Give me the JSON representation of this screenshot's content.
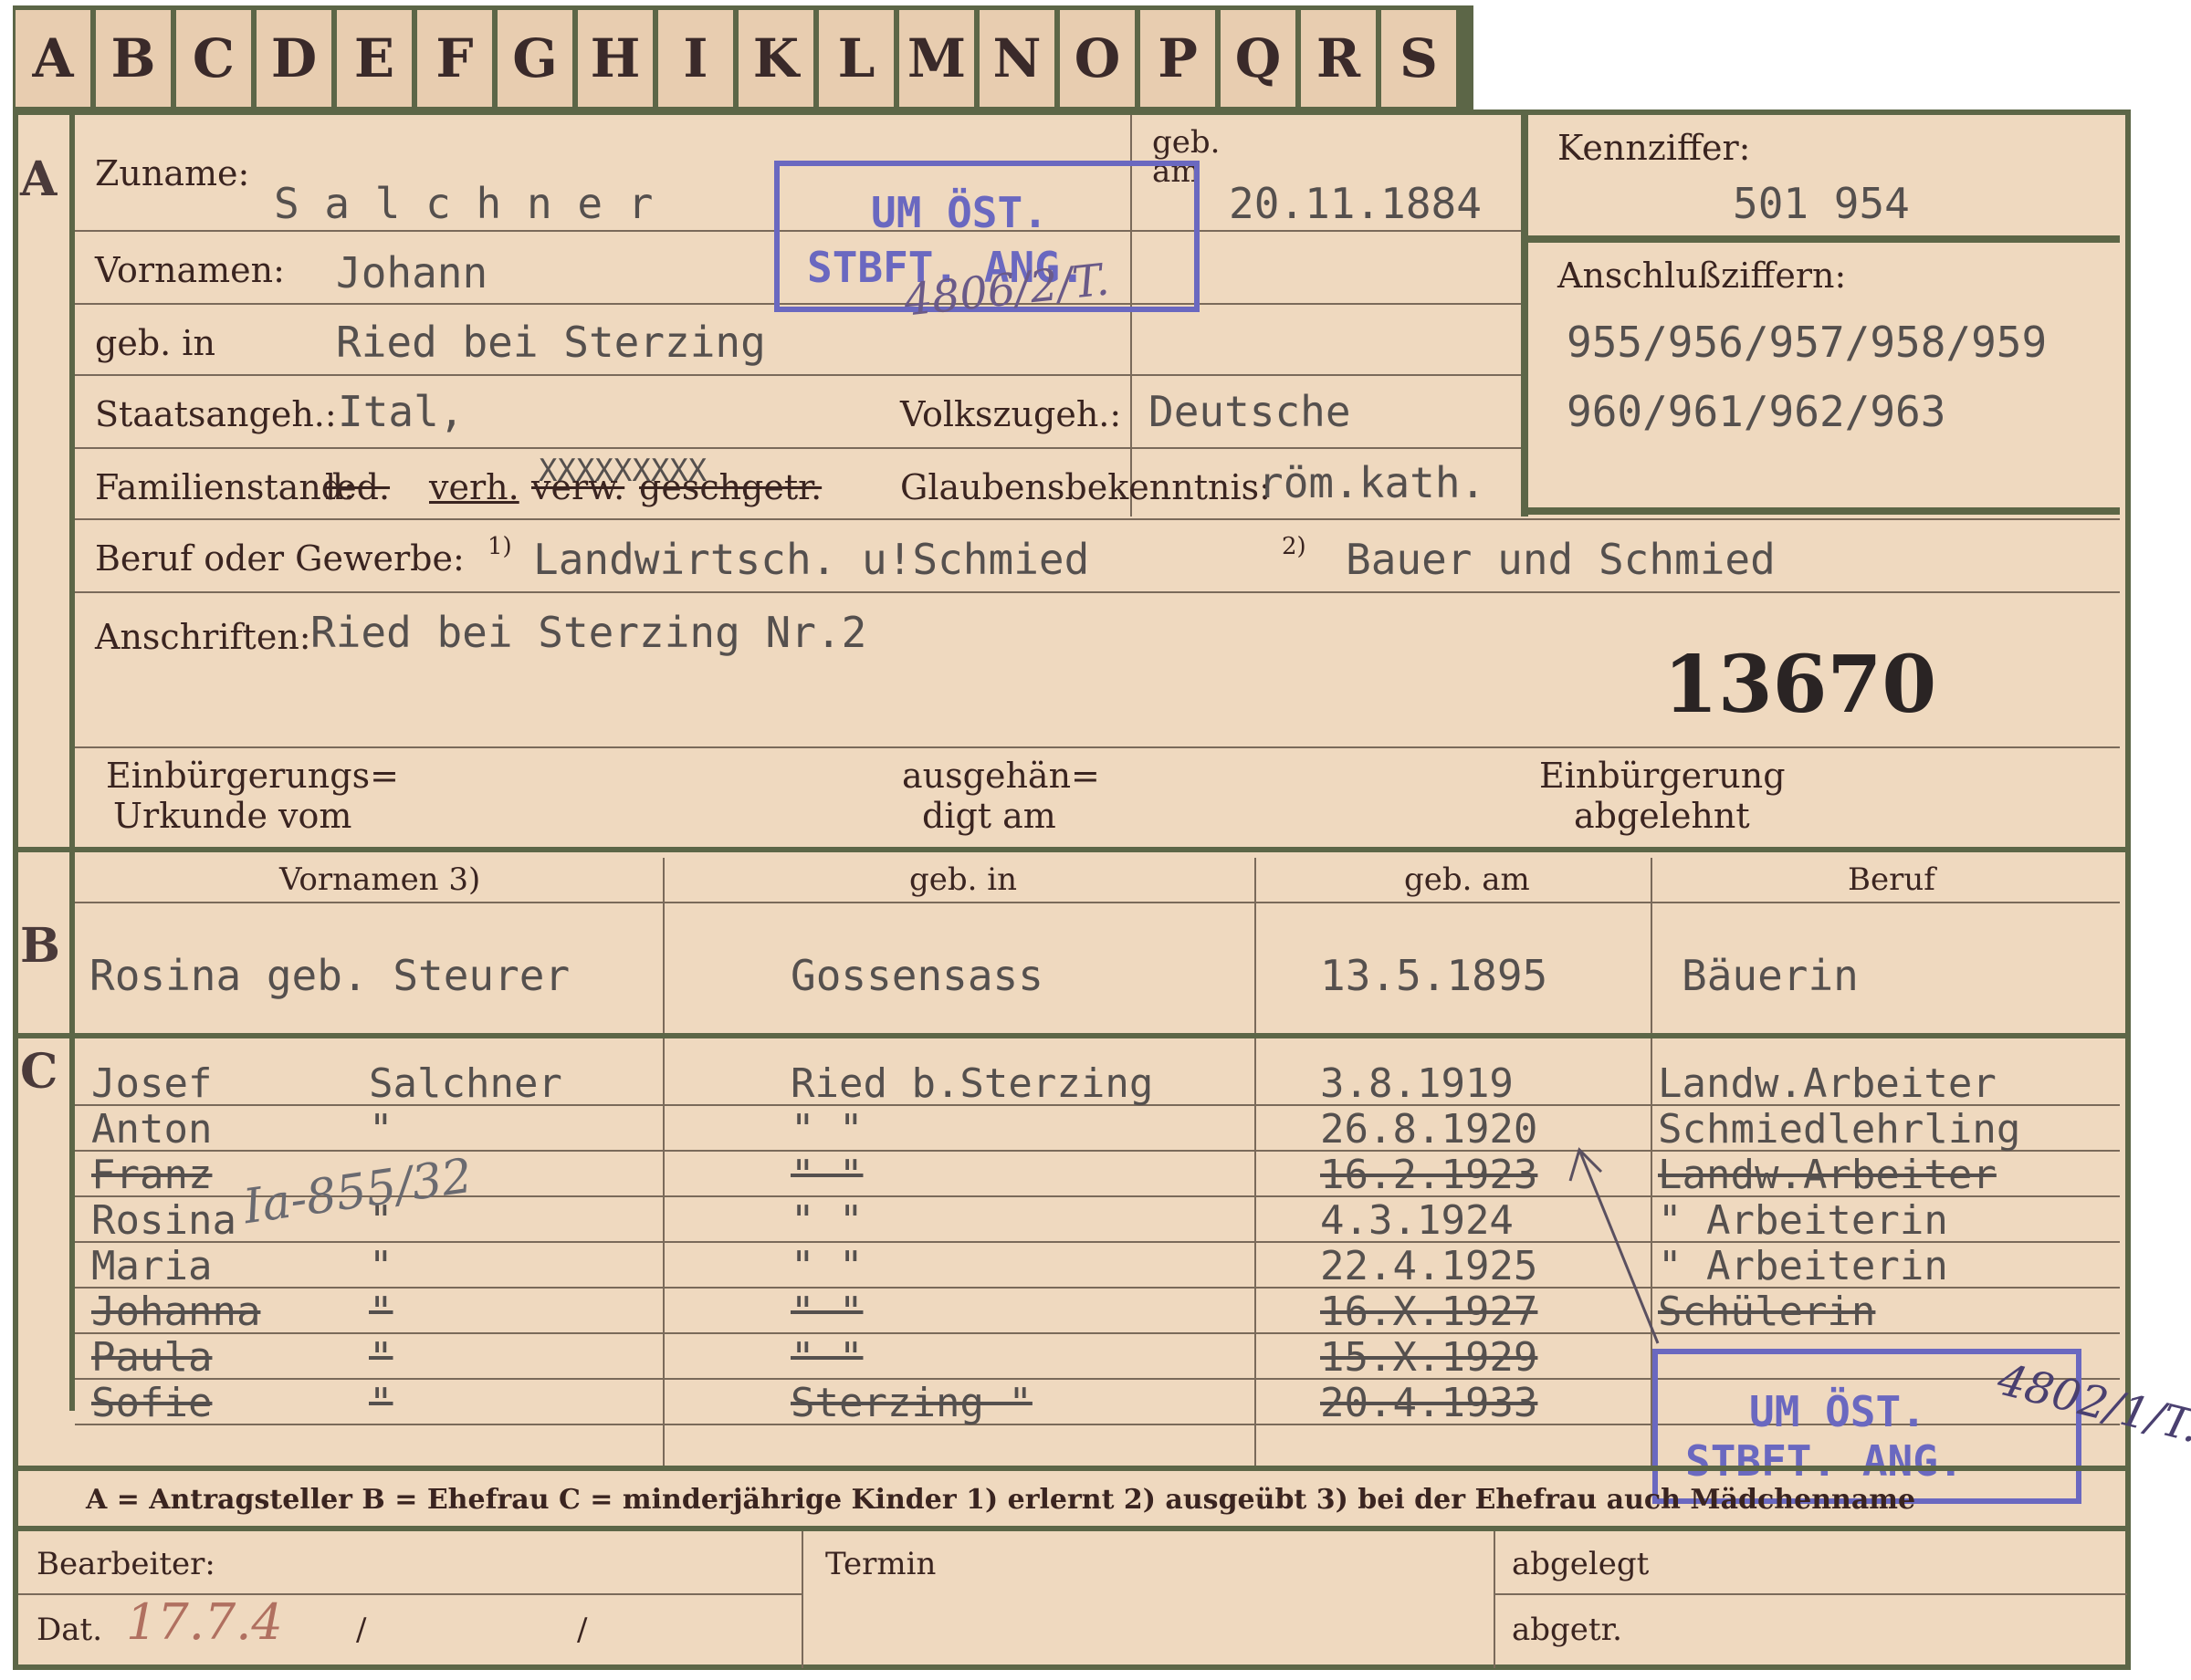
{
  "tabs": [
    "A",
    "B",
    "C",
    "D",
    "E",
    "F",
    "G",
    "H",
    "I",
    "K",
    "L",
    "M",
    "N",
    "O",
    "P",
    "Q",
    "R",
    "S"
  ],
  "section_letters": {
    "a": "A",
    "b": "B",
    "c": "C"
  },
  "a": {
    "zuname_label": "Zuname:",
    "zuname": "S a l c h n e r",
    "geb_label": "geb. am",
    "geb_date": "20.11.1884",
    "kennziffer_label": "Kennziffer:",
    "kennziffer": "501 954",
    "vornamen_label": "Vornamen:",
    "vornamen": "Johann",
    "geb_in_label": "geb. in",
    "geb_in": "Ried bei Sterzing",
    "anschluss_label": "Anschlußziffern:",
    "anschluss_1": "955/956/957/958/959",
    "anschluss_2": "960/961/962/963",
    "staats_label": "Staatsangeh.:",
    "staats": "Ital,",
    "volks_label": "Volkszugeh.:",
    "volks": "Deutsche",
    "familien_label": "Familienstand:",
    "familien_led": "led.",
    "familien_verh": "verh.",
    "familien_verw": "verw.",
    "familien_gesch": "gesch.",
    "familien_getr": "getr.",
    "familien_typed": "XXXXXXXXX",
    "glauben_label": "Glaubensbekenntnis:",
    "glauben": "röm.kath.",
    "beruf_label": "Beruf oder Gewerbe:",
    "beruf_1_mark": "1)",
    "beruf_1": "Landwirtsch. u!Schmied",
    "beruf_2_mark": "2)",
    "beruf_2": "Bauer und Schmied",
    "anschrift_label": "Anschriften:",
    "anschrift": "Ried bei Sterzing Nr.2",
    "number": "13670",
    "einb_urkunde_1": "Einbürgerungs=",
    "einb_urkunde_2": "Urkunde vom",
    "ausgehaend_1": "ausgehän=",
    "ausgehaend_2": "digt am",
    "einb_abgelehnt_1": "Einbürgerung",
    "einb_abgelehnt_2": "abgelehnt"
  },
  "stamp_top": {
    "line1": "UM ÖST.",
    "line2": "STBFT. ANG.",
    "hand": "4806/2/T."
  },
  "b": {
    "headers": {
      "vornamen": "Vornamen 3)",
      "geb_in": "geb. in",
      "geb_am": "geb. am",
      "beruf": "Beruf"
    },
    "vornamen": "Rosina geb. Steurer",
    "geb_in": "Gossensass",
    "geb_am": "13.5.1895",
    "beruf": "Bäuerin"
  },
  "c": {
    "rows": [
      {
        "name": "Josef",
        "surname": "Salchner",
        "place": "Ried b.Sterzing",
        "date": "3.8.1919",
        "job": "Landw.Arbeiter"
      },
      {
        "name": "Anton",
        "surname": "\"",
        "place": "\"          \"",
        "date": "26.8.1920",
        "job": "Schmiedlehrling"
      },
      {
        "name": "Franz",
        "surname": "",
        "place": "\"          \"",
        "date": "16.2.1923",
        "job": "Landw.Arbeiter"
      },
      {
        "name": "Rosina",
        "surname": "\"",
        "place": "\"          \"",
        "date": "4.3.1924",
        "job": "\"   Arbeiterin"
      },
      {
        "name": "Maria",
        "surname": "\"",
        "place": "\"          \"",
        "date": "22.4.1925",
        "job": "\"   Arbeiterin"
      },
      {
        "name": "Johanna",
        "surname": "\"",
        "place": "\"          \"",
        "date": "16.X.1927",
        "job": "Schülerin"
      },
      {
        "name": "Paula",
        "surname": "\"",
        "place": "\"          \"",
        "date": "15.X.1929",
        "job": ""
      },
      {
        "name": "Sofie",
        "surname": "\"",
        "place": "Sterzing    \"",
        "date": "20.4.1933",
        "job": ""
      }
    ],
    "franz_hand": "Ia-855/32"
  },
  "stamp_bottom": {
    "line1": "UM ÖST.",
    "line2": "STBFT. ANG.",
    "hand": "4802/1/T."
  },
  "legend": "A = Antragsteller   B = Ehefrau   C = minderjährige Kinder   1) erlernt   2) ausgeübt   3) bei der Ehefrau auch Mädchenname",
  "footer": {
    "bearbeiter": "Bearbeiter:",
    "dat": "Dat.",
    "dat_hand": "17.7.4",
    "slash1": "/",
    "slash2": "/",
    "termin": "Termin",
    "abgelegt": "abgelegt",
    "abgetr": "abgetr."
  }
}
